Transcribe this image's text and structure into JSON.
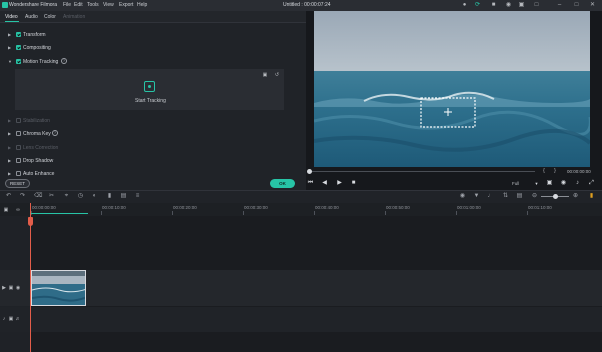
{
  "app": {
    "name": "Wondershare Filmora",
    "doc_title": "Untitled : 00:00:07:24"
  },
  "menu": [
    "File",
    "Edit",
    "Tools",
    "View",
    "Export",
    "Help"
  ],
  "tabs": [
    {
      "label": "Video",
      "active": true
    },
    {
      "label": "Audio",
      "active": false
    },
    {
      "label": "Color",
      "active": false
    },
    {
      "label": "Animation",
      "active": false,
      "disabled": true
    }
  ],
  "sections": [
    {
      "label": "Transform",
      "checked": true,
      "enabled": true
    },
    {
      "label": "Compositing",
      "checked": true,
      "enabled": true
    },
    {
      "label": "Motion Tracking",
      "checked": true,
      "enabled": true,
      "expanded": true
    },
    {
      "label": "Stabilization",
      "checked": false,
      "enabled": false
    },
    {
      "label": "Chroma Key",
      "checked": false,
      "enabled": true
    },
    {
      "label": "Lens Correction",
      "checked": false,
      "enabled": false
    },
    {
      "label": "Drop Shadow",
      "checked": false,
      "enabled": true
    },
    {
      "label": "Auto Enhance",
      "checked": false,
      "enabled": true
    }
  ],
  "motion_tracking": {
    "start_label": "Start Tracking"
  },
  "buttons": {
    "reset": "RESET",
    "ok": "OK"
  },
  "player": {
    "time_code": "00:00:00:00",
    "quality": "Full"
  },
  "ruler": {
    "labels": [
      "00:00:00:00",
      "00:00:10:00",
      "00:00:20:00",
      "00:00:30:00",
      "00:00:40:00",
      "00:00:50:00",
      "00:01:00:00",
      "00:01:10:00"
    ]
  },
  "clip": {
    "name": ""
  },
  "colors": {
    "accent": "#27c4a6",
    "playhead": "#e25d4a"
  }
}
